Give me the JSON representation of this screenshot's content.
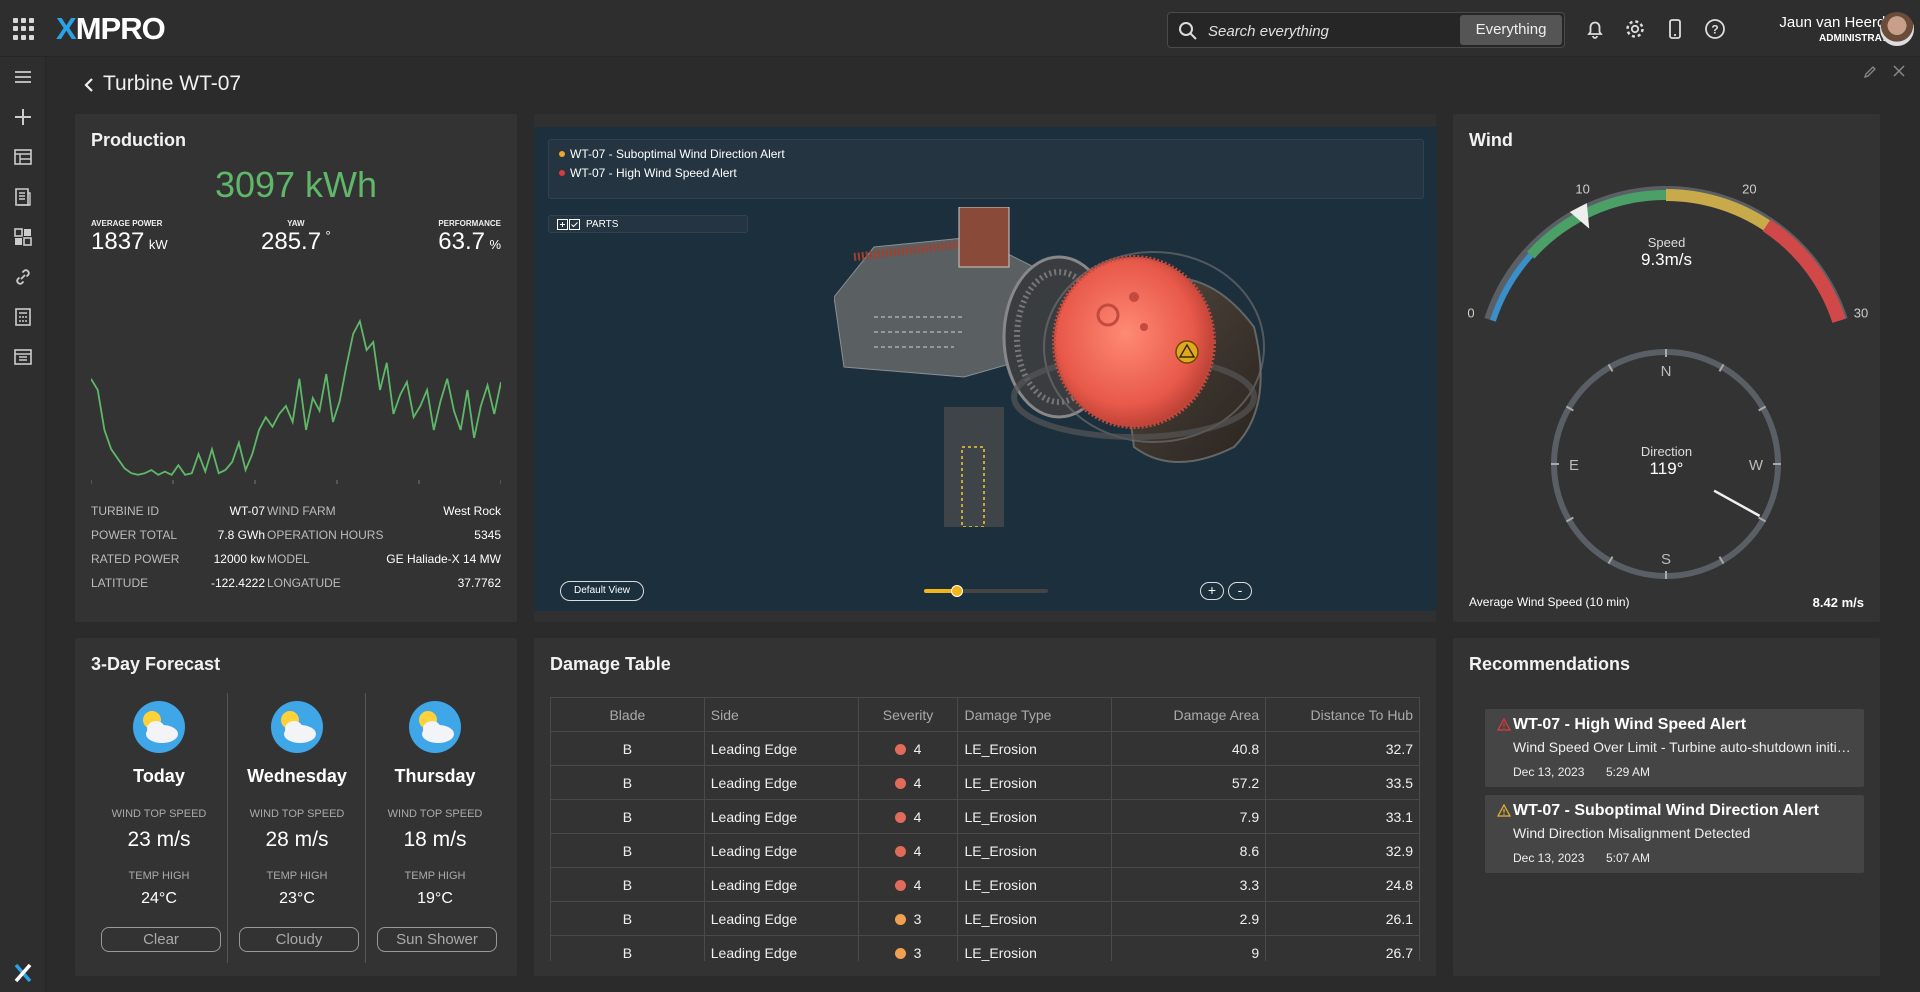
{
  "app": {
    "brand_prefix": "X",
    "brand_rest": "MPRO"
  },
  "search": {
    "placeholder": "Search everything",
    "scope": "Everything"
  },
  "user": {
    "name": "Jaun van Heerden",
    "role": "ADMINISTRATOR"
  },
  "page": {
    "title": "Turbine WT-07"
  },
  "production": {
    "title": "Production",
    "total": "3097 kWh",
    "metrics": [
      {
        "label": "AVERAGE POWER",
        "value": "1837",
        "unit": "kW"
      },
      {
        "label": "YAW",
        "value": "285.7",
        "unit": "°"
      },
      {
        "label": "PERFORMANCE",
        "value": "63.7",
        "unit": "%"
      }
    ],
    "sparkline": [
      0.62,
      0.55,
      0.3,
      0.18,
      0.12,
      0.06,
      0.03,
      0.02,
      0.03,
      0.05,
      0.02,
      0.04,
      0.02,
      0.08,
      0.02,
      0.03,
      0.15,
      0.04,
      0.18,
      0.03,
      0.05,
      0.1,
      0.22,
      0.05,
      0.15,
      0.3,
      0.38,
      0.32,
      0.4,
      0.45,
      0.35,
      0.62,
      0.3,
      0.5,
      0.42,
      0.65,
      0.35,
      0.48,
      0.7,
      0.9,
      0.98,
      0.8,
      0.85,
      0.55,
      0.72,
      0.4,
      0.52,
      0.6,
      0.38,
      0.45,
      0.55,
      0.3,
      0.48,
      0.62,
      0.42,
      0.3,
      0.55,
      0.25,
      0.45,
      0.58,
      0.4,
      0.6
    ],
    "info": [
      {
        "l1": "TURBINE ID",
        "v1": "WT-07",
        "l2": "WIND FARM",
        "v2": "West Rock"
      },
      {
        "l1": "POWER TOTAL",
        "v1": "7.8 GWh",
        "l2": "OPERATION HOURS",
        "v2": "5345"
      },
      {
        "l1": "RATED POWER",
        "v1": "12000 kw",
        "l2": "MODEL",
        "v2": "GE Haliade-X 14 MW"
      },
      {
        "l1": "LATITUDE",
        "v1": "-122.4222",
        "l2": "LONGATUDE",
        "v2": "37.7762"
      }
    ]
  },
  "viewer": {
    "alerts": [
      {
        "text": "WT-07 - Suboptimal Wind Direction Alert",
        "color": "#f0a52b"
      },
      {
        "text": "WT-07 - High Wind Speed Alert",
        "color": "#d93a3a"
      }
    ],
    "parts_label": "PARTS",
    "default_view": "Default View",
    "zoom_in": "+",
    "zoom_out": "-",
    "slider_level": 0.27
  },
  "wind": {
    "title": "Wind",
    "speed_label": "Speed",
    "speed_value": "9.3m/s",
    "speed_numeric": 9.3,
    "gauge_ticks": [
      "0",
      "10",
      "20",
      "30"
    ],
    "direction_label": "Direction",
    "direction_value": "119°",
    "direction_numeric": 119,
    "compass": [
      "N",
      "E",
      "W",
      "S"
    ],
    "avg_label": "Average Wind Speed (10 min)",
    "avg_value": "8.42 m/s"
  },
  "forecast": {
    "title": "3-Day Forecast",
    "days": [
      {
        "day": "Today",
        "wind_label": "WIND TOP SPEED",
        "wind": "23 m/s",
        "temp_label": "TEMP HIGH",
        "temp": "24°C",
        "cond": "Clear",
        "icon": "partly-sunny-icon"
      },
      {
        "day": "Wednesday",
        "wind_label": "WIND TOP SPEED",
        "wind": "28 m/s",
        "temp_label": "TEMP HIGH",
        "temp": "23°C",
        "cond": "Cloudy",
        "icon": "cloudy-icon"
      },
      {
        "day": "Thursday",
        "wind_label": "WIND TOP SPEED",
        "wind": "18 m/s",
        "temp_label": "TEMP HIGH",
        "temp": "19°C",
        "cond": "Sun Shower",
        "icon": "sun-shower-icon"
      }
    ]
  },
  "damage": {
    "title": "Damage Table",
    "columns": [
      "Blade",
      "Side",
      "Severity",
      "Damage Type",
      "Damage Area",
      "Distance To Hub"
    ],
    "rows": [
      {
        "blade": "B",
        "side": "Leading Edge",
        "severity": "4",
        "sev_color": "#e06b5a",
        "type": "LE_Erosion",
        "area": "40.8",
        "dist": "32.7"
      },
      {
        "blade": "B",
        "side": "Leading Edge",
        "severity": "4",
        "sev_color": "#e06b5a",
        "type": "LE_Erosion",
        "area": "57.2",
        "dist": "33.5"
      },
      {
        "blade": "B",
        "side": "Leading Edge",
        "severity": "4",
        "sev_color": "#e06b5a",
        "type": "LE_Erosion",
        "area": "7.9",
        "dist": "33.1"
      },
      {
        "blade": "B",
        "side": "Leading Edge",
        "severity": "4",
        "sev_color": "#e06b5a",
        "type": "LE_Erosion",
        "area": "8.6",
        "dist": "32.9"
      },
      {
        "blade": "B",
        "side": "Leading Edge",
        "severity": "4",
        "sev_color": "#e06b5a",
        "type": "LE_Erosion",
        "area": "3.3",
        "dist": "24.8"
      },
      {
        "blade": "B",
        "side": "Leading Edge",
        "severity": "3",
        "sev_color": "#f0a052",
        "type": "LE_Erosion",
        "area": "2.9",
        "dist": "26.1"
      },
      {
        "blade": "B",
        "side": "Leading Edge",
        "severity": "3",
        "sev_color": "#f0a052",
        "type": "LE_Erosion",
        "area": "9",
        "dist": "26.7"
      }
    ]
  },
  "recommendations": {
    "title": "Recommendations",
    "items": [
      {
        "title": "WT-07 - High Wind Speed Alert",
        "desc": "Wind Speed Over Limit - Turbine auto-shutdown initiated",
        "date": "Dec 13, 2023",
        "time": "5:29 AM",
        "color": "#d93a3a"
      },
      {
        "title": "WT-07 - Suboptimal Wind Direction Alert",
        "desc": "Wind Direction Misalignment Detected",
        "date": "Dec 13, 2023",
        "time": "5:07 AM",
        "color": "#e0b030"
      }
    ]
  }
}
